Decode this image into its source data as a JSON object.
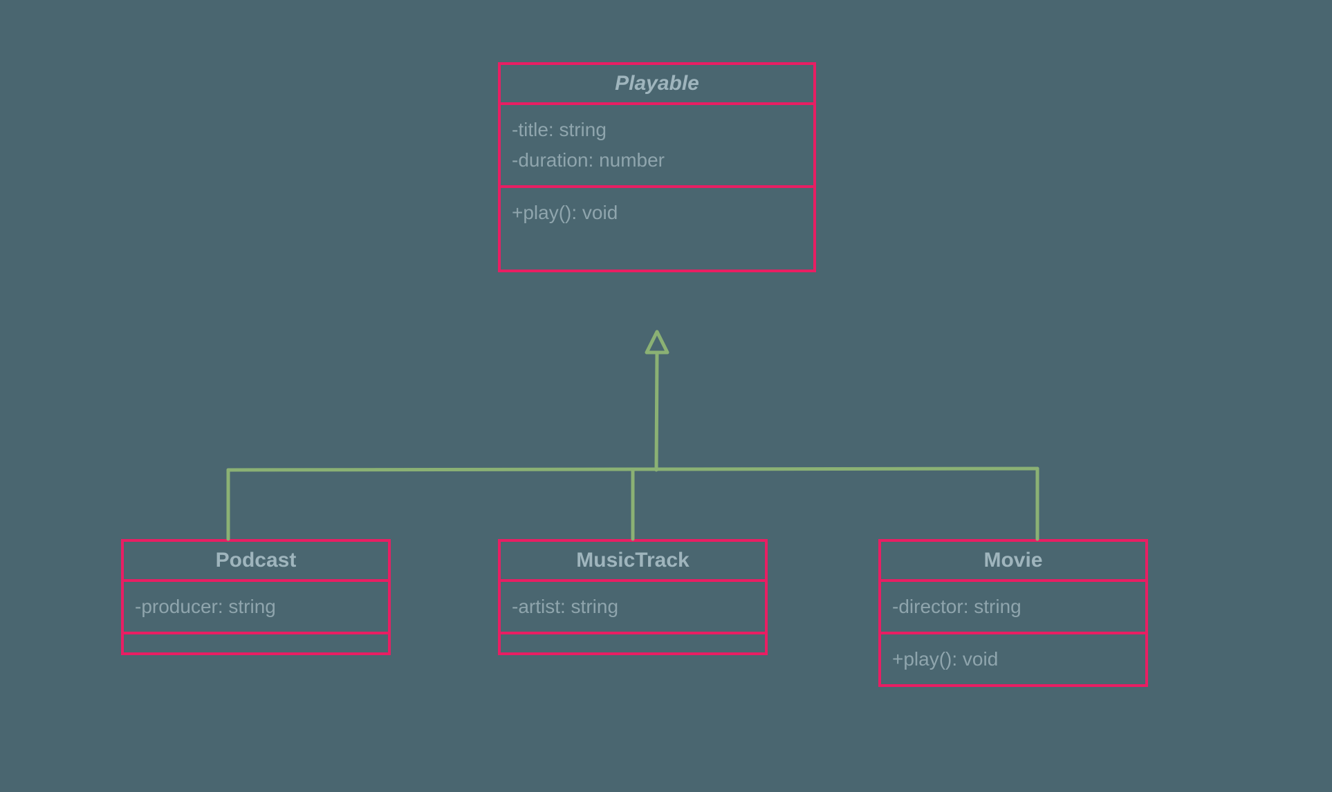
{
  "diagram": {
    "parent": {
      "name": "Playable",
      "attributes": [
        "-title: string",
        "-duration: number"
      ],
      "methods": [
        "+play(): void"
      ]
    },
    "children": [
      {
        "name": "Podcast",
        "attributes": [
          "-producer: string"
        ],
        "methods": []
      },
      {
        "name": "MusicTrack",
        "attributes": [
          "-artist: string"
        ],
        "methods": []
      },
      {
        "name": "Movie",
        "attributes": [
          "-director: string"
        ],
        "methods": [
          "+play(): void"
        ]
      }
    ],
    "colors": {
      "background": "#4a6670",
      "border": "#e91e63",
      "text": "#8fa5ad",
      "connector": "#8bb174"
    }
  }
}
